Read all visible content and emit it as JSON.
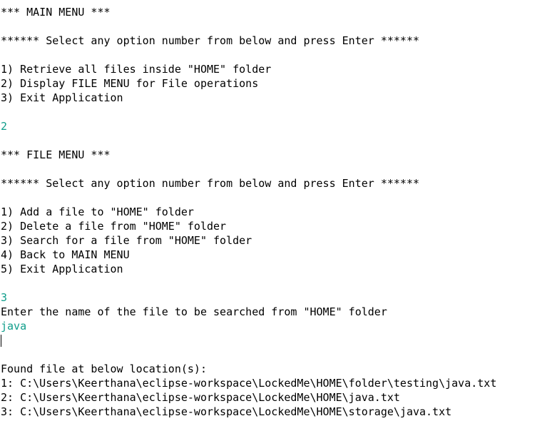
{
  "console": {
    "lines": [
      {
        "text": "*** MAIN MENU ***",
        "type": "output"
      },
      {
        "text": "",
        "type": "blank"
      },
      {
        "text": "****** Select any option number from below and press Enter ******",
        "type": "output"
      },
      {
        "text": "",
        "type": "blank"
      },
      {
        "text": "1) Retrieve all files inside \"HOME\" folder",
        "type": "output"
      },
      {
        "text": "2) Display FILE MENU for File operations",
        "type": "output"
      },
      {
        "text": "3) Exit Application",
        "type": "output"
      },
      {
        "text": "",
        "type": "blank"
      },
      {
        "text": "2",
        "type": "input"
      },
      {
        "text": "",
        "type": "blank"
      },
      {
        "text": "*** FILE MENU ***",
        "type": "output"
      },
      {
        "text": "",
        "type": "blank"
      },
      {
        "text": "****** Select any option number from below and press Enter ******",
        "type": "output"
      },
      {
        "text": "",
        "type": "blank"
      },
      {
        "text": "1) Add a file to \"HOME\" folder",
        "type": "output"
      },
      {
        "text": "2) Delete a file from \"HOME\" folder",
        "type": "output"
      },
      {
        "text": "3) Search for a file from \"HOME\" folder",
        "type": "output"
      },
      {
        "text": "4) Back to MAIN MENU",
        "type": "output"
      },
      {
        "text": "5) Exit Application",
        "type": "output"
      },
      {
        "text": "",
        "type": "blank"
      },
      {
        "text": "3",
        "type": "input"
      },
      {
        "text": "Enter the name of the file to be searched from \"HOME\" folder",
        "type": "output"
      },
      {
        "text": "java",
        "type": "input"
      },
      {
        "text": "",
        "type": "caret"
      },
      {
        "text": "",
        "type": "blank"
      },
      {
        "text": "Found file at below location(s):",
        "type": "output"
      },
      {
        "text": "1: C:\\Users\\Keerthana\\eclipse-workspace\\LockedMe\\HOME\\folder\\testing\\java.txt",
        "type": "output"
      },
      {
        "text": "2: C:\\Users\\Keerthana\\eclipse-workspace\\LockedMe\\HOME\\java.txt",
        "type": "output"
      },
      {
        "text": "3: C:\\Users\\Keerthana\\eclipse-workspace\\LockedMe\\HOME\\storage\\java.txt",
        "type": "output"
      }
    ]
  },
  "colors": {
    "background": "#ffffff",
    "output_text": "#000000",
    "input_text": "#0f9d8a"
  }
}
